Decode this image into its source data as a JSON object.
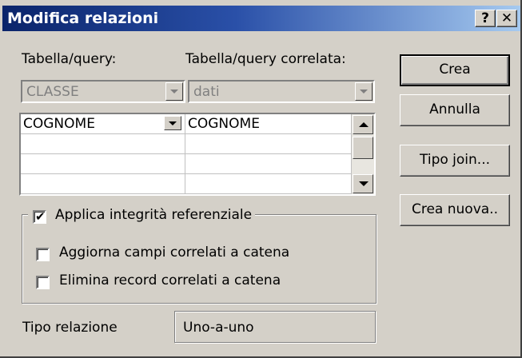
{
  "window": {
    "title": "Modifica relazioni"
  },
  "title_buttons": {
    "help": "?",
    "close": "✕"
  },
  "labels": {
    "table": "Tabella/query:",
    "related_table": "Tabella/query correlata:"
  },
  "combos": {
    "table": "CLASSE",
    "related_table": "dati"
  },
  "grid": {
    "rows": [
      [
        "COGNOME",
        "COGNOME"
      ],
      [
        "",
        ""
      ],
      [
        "",
        ""
      ],
      [
        "",
        ""
      ]
    ]
  },
  "buttons": {
    "create": "Crea",
    "cancel": "Annulla",
    "join_type": "Tipo join...",
    "create_new": "Crea nuova.."
  },
  "options": {
    "enforce_integrity": {
      "label": "Applica integrità referenziale",
      "checked": true
    },
    "cascade_update": {
      "label": "Aggiorna campi correlati a catena",
      "checked": false
    },
    "cascade_delete": {
      "label": "Elimina record correlati a catena",
      "checked": false
    }
  },
  "relationship": {
    "label": "Tipo relazione",
    "value": "Uno-a-uno"
  }
}
